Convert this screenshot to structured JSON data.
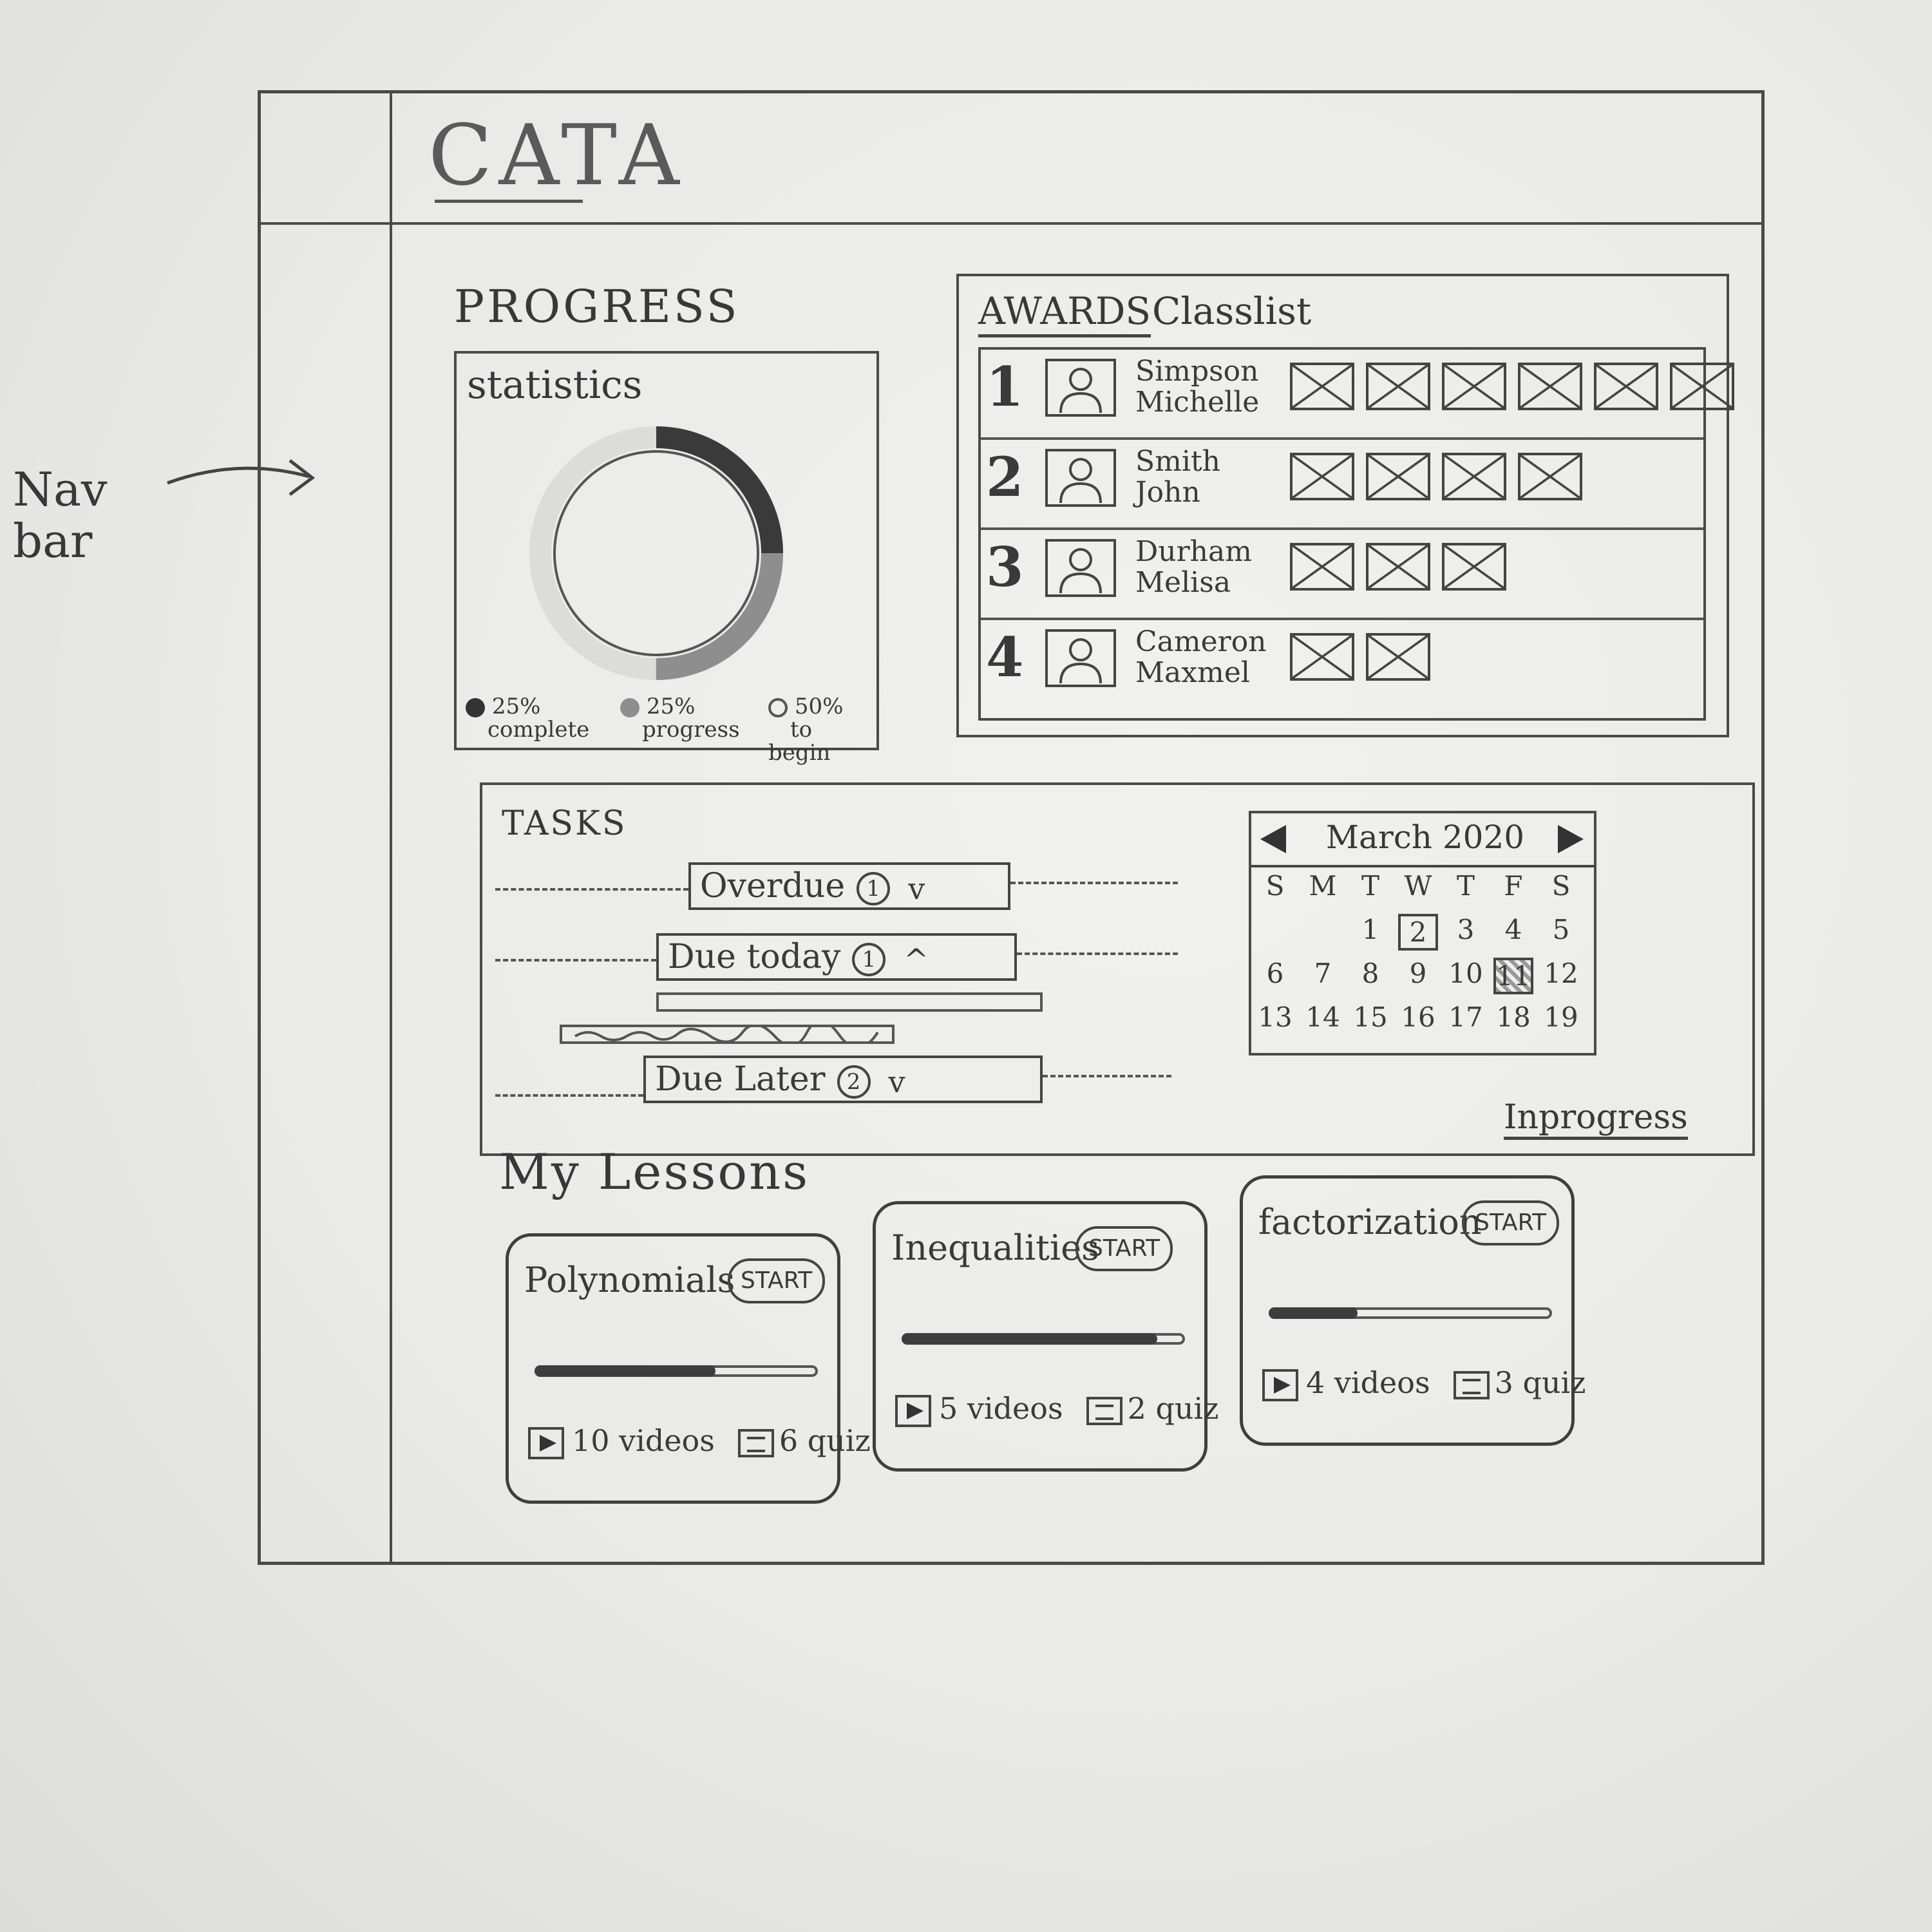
{
  "app": {
    "logo": "CATA"
  },
  "annotations": {
    "nav_bar_note": "Nav bar",
    "in_progress_link": "Inprogress"
  },
  "progress": {
    "section_title": "PROGRESS",
    "statistics": {
      "title": "statistics",
      "donut": {
        "complete_pct": 25,
        "progress_pct": 25,
        "to_begin_pct": 50
      },
      "legend": [
        {
          "value": "25%",
          "label": "complete"
        },
        {
          "value": "25%",
          "label": "progress"
        },
        {
          "value": "50%",
          "label": "to begin"
        }
      ]
    }
  },
  "awards": {
    "tabs": [
      {
        "label": "AWARDS"
      },
      {
        "label": "Classlist"
      }
    ],
    "rows": [
      {
        "rank": "1",
        "surname": "Simpson",
        "first": "Michelle",
        "awards": 6
      },
      {
        "rank": "2",
        "surname": "Smith",
        "first": "John",
        "awards": 4
      },
      {
        "rank": "3",
        "surname": "Durham",
        "first": "Melisa",
        "awards": 3
      },
      {
        "rank": "4",
        "surname": "Cameron",
        "first": "Maxmel",
        "awards": 2
      }
    ]
  },
  "tasks": {
    "title": "TASKS",
    "groups": [
      {
        "label": "Overdue",
        "count": "1",
        "chevron": "v"
      },
      {
        "label": "Due today",
        "count": "1",
        "chevron": "^"
      },
      {
        "label": "Due Later",
        "count": "2",
        "chevron": "v"
      }
    ]
  },
  "calendar": {
    "month": "March 2020",
    "weekdays": [
      "S",
      "M",
      "T",
      "W",
      "T",
      "F",
      "S"
    ],
    "rows": [
      [
        "",
        "",
        "1",
        "2",
        "3",
        "4",
        "5"
      ],
      [
        "6",
        "7",
        "8",
        "9",
        "10",
        "11",
        "12"
      ],
      [
        "13",
        "14",
        "15",
        "16",
        "17",
        "18",
        "19"
      ]
    ],
    "selected": "2",
    "highlighted": "11"
  },
  "lessons": {
    "title": "My Lessons",
    "items": [
      {
        "title": "Polynomials",
        "start": "START",
        "progress": 0.65,
        "videos": "10 videos",
        "quiz": "6 quiz"
      },
      {
        "title": "Inequalities",
        "start": "START",
        "progress": 0.92,
        "videos": "5 videos",
        "quiz": "2 quiz"
      },
      {
        "title": "factorization",
        "start": "START",
        "progress": 0.32,
        "videos": "4 videos",
        "quiz": "3 quiz"
      }
    ]
  }
}
